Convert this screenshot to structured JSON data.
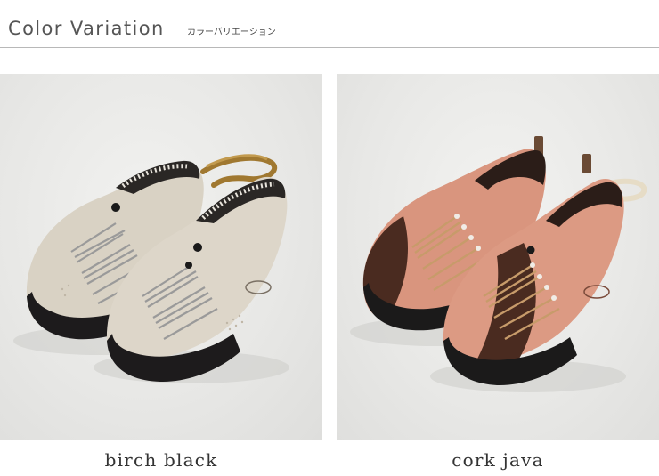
{
  "header": {
    "title": "Color Variation",
    "subtitle": "カラーバリエーション"
  },
  "variants": [
    {
      "name": "birch black",
      "upper": "#d9d2c4",
      "toe": "#1d1b1c"
    },
    {
      "name": "cork java",
      "upper": "#d9957e",
      "accent": "#4a2b20",
      "toe": "#1b1a1a"
    }
  ]
}
